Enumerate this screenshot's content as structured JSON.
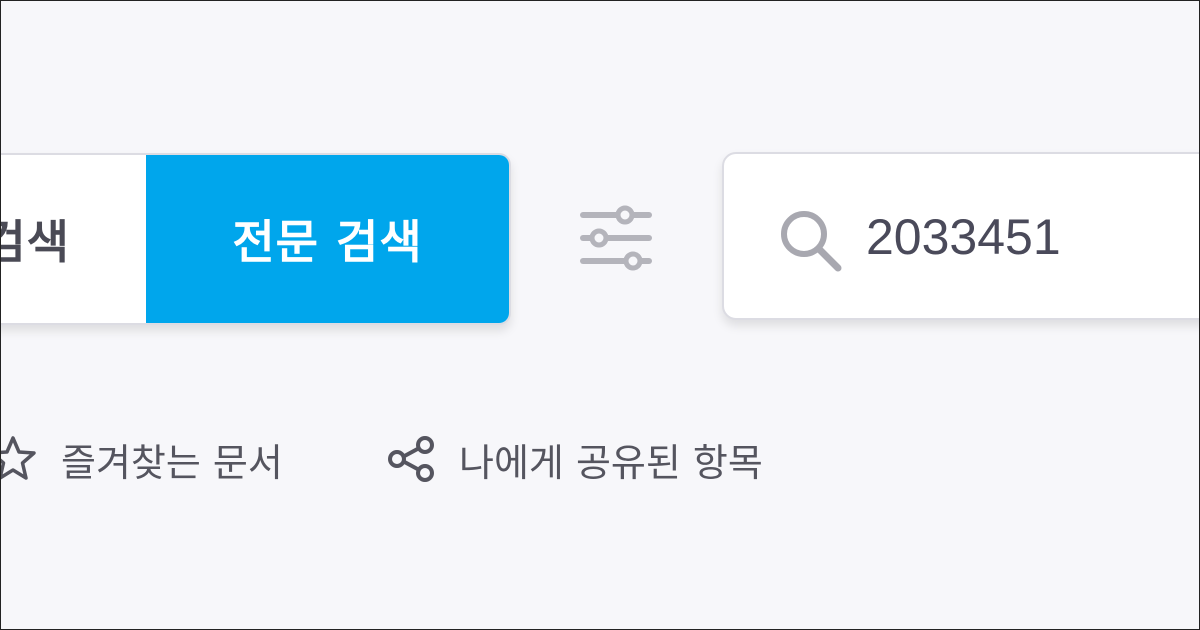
{
  "search_mode": {
    "basic_label": "통합 검색",
    "basic_visible_label": "검색",
    "full_label": "전문 검색",
    "active": "full"
  },
  "filter": {
    "icon": "sliders-icon"
  },
  "search": {
    "icon": "search-icon",
    "value": "2033451"
  },
  "quick_links": {
    "favorites_label": "즐겨찾는 문서",
    "favorites_icon": "star-icon",
    "shared_label": "나에게 공유된 항목",
    "shared_icon": "share-icon"
  },
  "colors": {
    "accent": "#00a6ec",
    "background": "#f7f7fa",
    "text": "#4a4a55",
    "icon_muted": "#b4b4bb"
  }
}
